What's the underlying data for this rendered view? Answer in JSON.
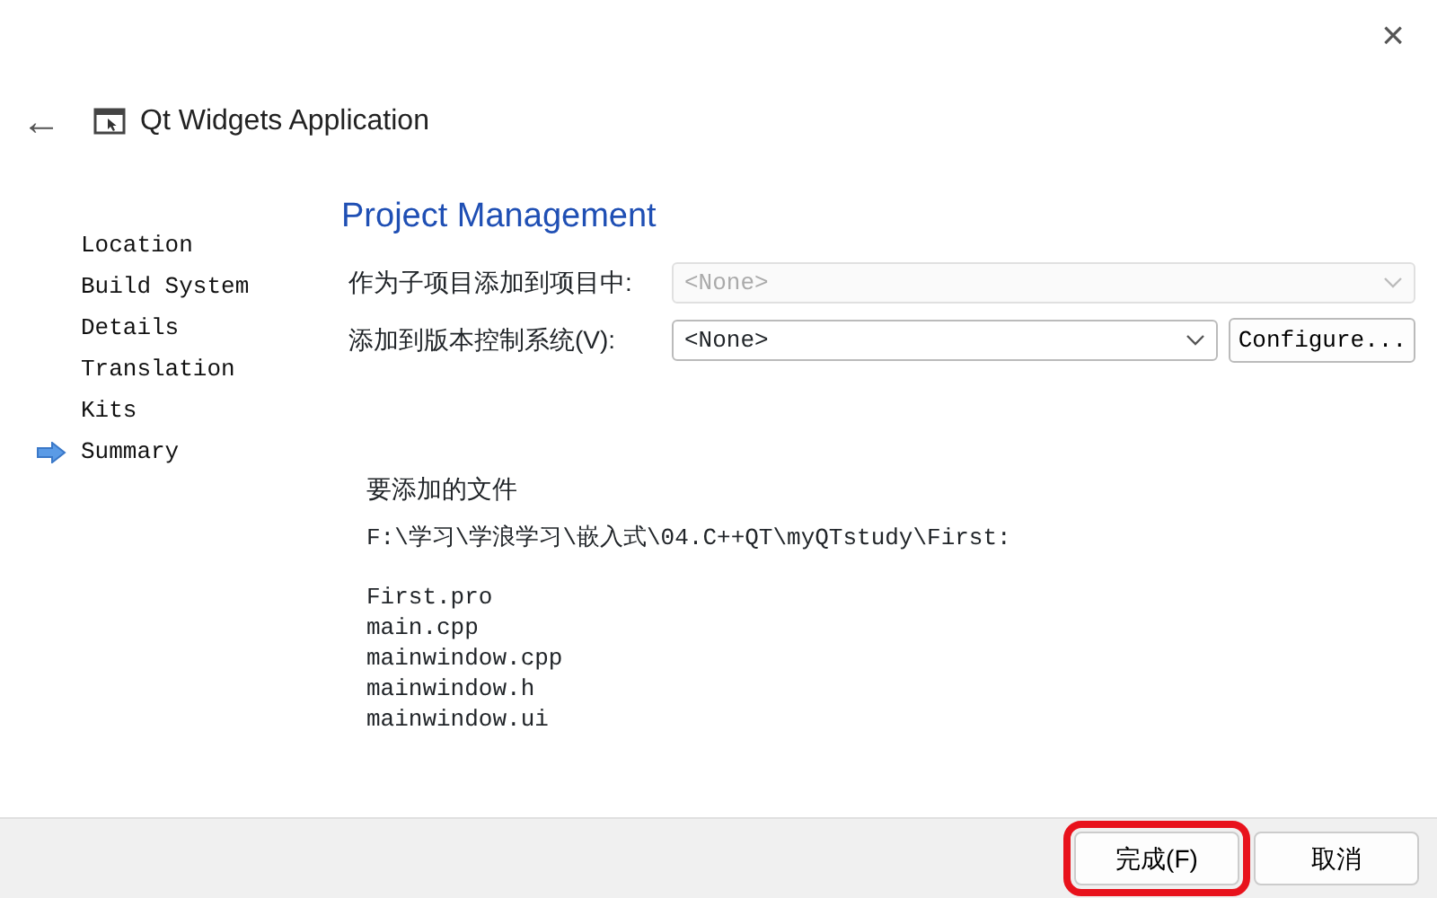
{
  "window": {
    "close": "×"
  },
  "header": {
    "back": "←",
    "title": "Qt Widgets Application"
  },
  "sidebar": {
    "items": [
      {
        "label": "Location",
        "selected": false
      },
      {
        "label": "Build System",
        "selected": false
      },
      {
        "label": "Details",
        "selected": false
      },
      {
        "label": "Translation",
        "selected": false
      },
      {
        "label": "Kits",
        "selected": false
      },
      {
        "label": "Summary",
        "selected": true
      }
    ]
  },
  "page": {
    "title": "Project Management",
    "fields": [
      {
        "label": "作为子项目添加到项目中:",
        "value": "<None>",
        "disabled": true
      },
      {
        "label": "添加到版本控制系统(V):",
        "value": "<None>",
        "disabled": false,
        "button": "Configure..."
      }
    ],
    "files_heading": "要添加的文件",
    "files_path": "F:\\学习\\学浪学习\\嵌入式\\04.C++QT\\myQTstudy\\First:",
    "files": [
      "First.pro",
      "main.cpp",
      "mainwindow.cpp",
      "mainwindow.h",
      "mainwindow.ui"
    ]
  },
  "buttons": [
    {
      "label": "完成(F)",
      "annotated": true
    },
    {
      "label": "取消",
      "annotated": false
    }
  ]
}
